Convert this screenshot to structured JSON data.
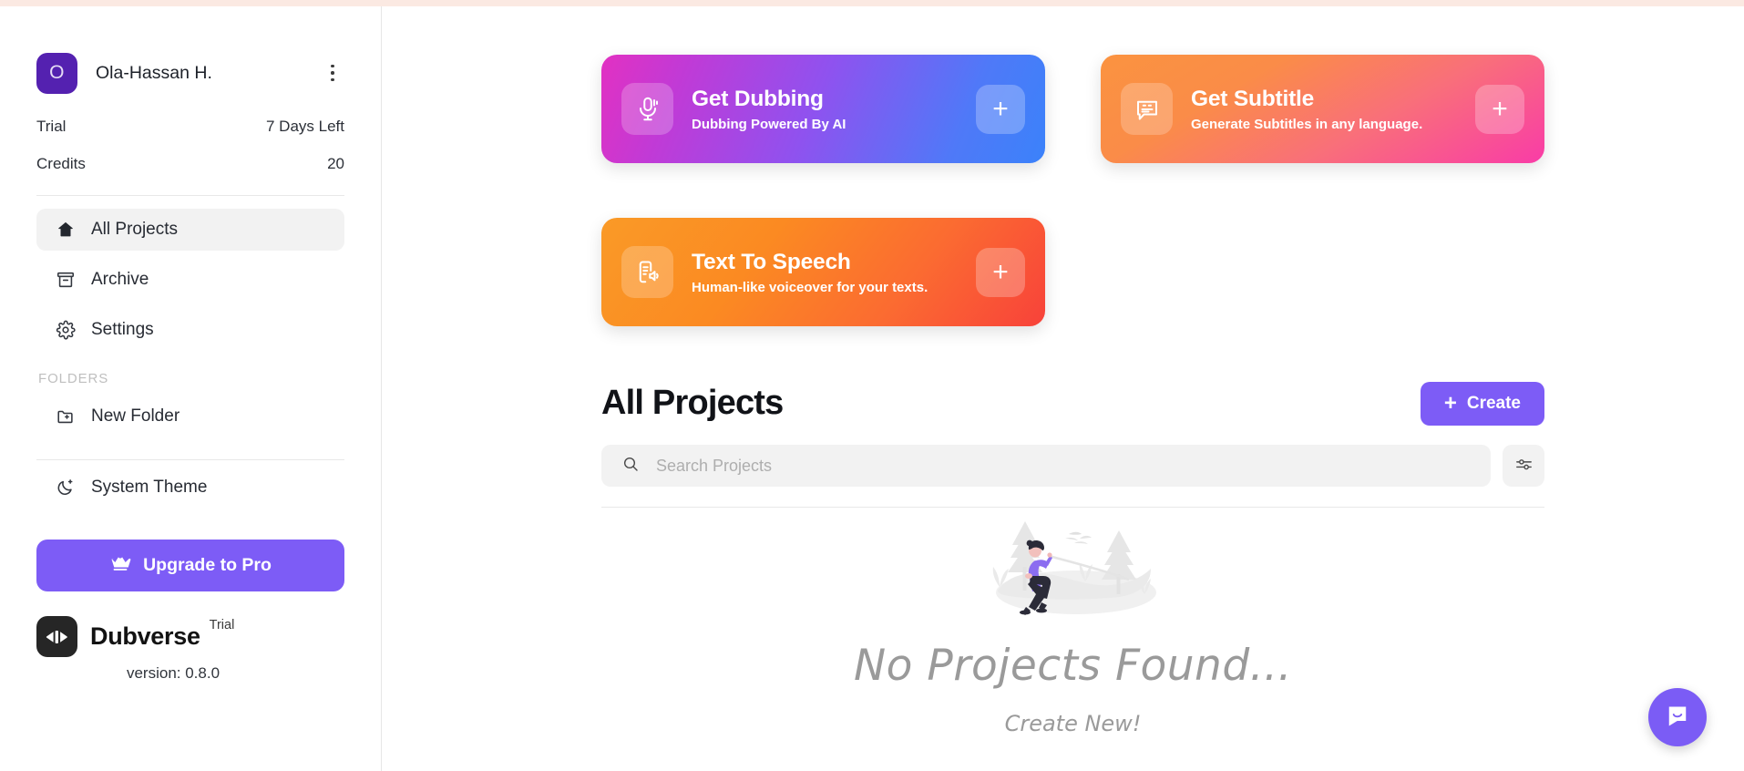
{
  "sidebar": {
    "profile": {
      "avatar_initial": "O",
      "name": "Ola-Hassan H.",
      "menu_icon": "kebab-menu-icon"
    },
    "plan": {
      "label": "Trial",
      "value": "7 Days Left"
    },
    "credits": {
      "label": "Credits",
      "value": "20"
    },
    "nav": [
      {
        "label": "All Projects",
        "icon": "home-icon",
        "active": true
      },
      {
        "label": "Archive",
        "icon": "archive-icon",
        "active": false
      },
      {
        "label": "Settings",
        "icon": "gear-icon",
        "active": false
      }
    ],
    "folders_label": "FOLDERS",
    "new_folder": {
      "label": "New Folder",
      "icon": "folder-plus-icon"
    },
    "theme": {
      "label": "System Theme",
      "icon": "moon-icon"
    },
    "upgrade": {
      "label": "Upgrade to Pro",
      "icon": "crown-icon"
    },
    "brand": {
      "name": "Dubverse",
      "badge": "Trial",
      "version": "version: 0.8.0",
      "logo_icon": "dubverse-logo-icon"
    }
  },
  "cards": [
    {
      "title": "Get Dubbing",
      "subtitle": "Dubbing Powered By AI",
      "icon": "microphone-icon",
      "plus": "+",
      "gradient_from": "#e231c2",
      "gradient_to": "#3b82fa"
    },
    {
      "title": "Get Subtitle",
      "subtitle": "Generate Subtitles in any language.",
      "icon": "closed-caption-bubble-icon",
      "plus": "+",
      "gradient_from": "#fb9340",
      "gradient_to": "#f93ca7"
    },
    {
      "title": "Text To Speech",
      "subtitle": "Human-like voiceover for your texts.",
      "icon": "document-speaker-icon",
      "plus": "+",
      "gradient_from": "#fa9a27",
      "gradient_to": "#f8423a"
    }
  ],
  "projects": {
    "title": "All Projects",
    "create_label": "Create",
    "create_plus": "+",
    "search_placeholder": "Search Projects",
    "search_value": "",
    "search_icon": "search-icon",
    "filter_icon": "sliders-icon"
  },
  "empty_state": {
    "title": "No Projects Found...",
    "subtitle": "Create New!",
    "illustration": "person-on-swing-illustration"
  },
  "chat": {
    "icon": "intercom-chat-icon"
  },
  "colors": {
    "accent_purple": "#7d5cf6",
    "avatar_purple": "#5421b0",
    "top_strip": "#fbe9e2",
    "muted_grey": "#9a9a9a"
  }
}
